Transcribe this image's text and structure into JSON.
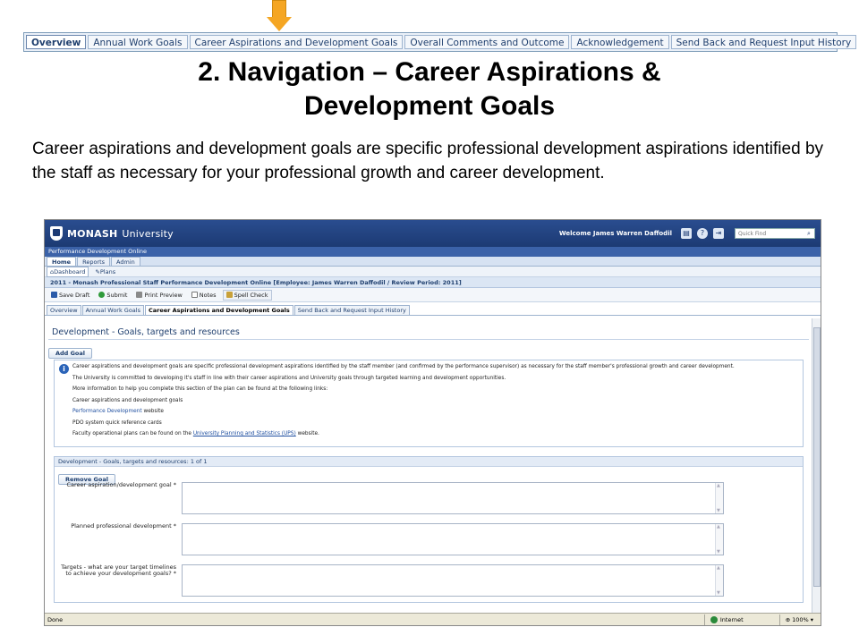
{
  "top_tabs": [
    "Overview",
    "Annual Work Goals",
    "Career Aspirations and Development Goals",
    "Overall Comments and Outcome",
    "Acknowledgement",
    "Send Back and Request Input History"
  ],
  "slide": {
    "title_line1": "2. Navigation – Career Aspirations &",
    "title_line2": "Development Goals",
    "intro": "Career aspirations and development goals are specific professional development aspirations identified by the staff as necessary for your professional growth and career development."
  },
  "app": {
    "logo_main": "MONASH",
    "logo_sub": "University",
    "welcome": "Welcome James Warren Daffodil",
    "quickfind_placeholder": "Quick Find",
    "pdo_bar": "Performance Development Online",
    "nav": [
      "Home",
      "Reports",
      "Admin"
    ],
    "subnav": [
      "Dashboard",
      "Plans"
    ],
    "plan_title": "2011 - Monash Professional Staff Performance Development Online [Employee: James Warren Daffodil / Review Period: 2011]",
    "toolbar": {
      "save_draft": "Save Draft",
      "submit": "Submit",
      "print_preview": "Print Preview",
      "notes": "Notes",
      "spell_check": "Spell Check"
    },
    "form_tabs": [
      "Overview",
      "Annual Work Goals",
      "Career Aspirations and Development Goals",
      "Send Back and Request Input History"
    ],
    "section_title": "Development - Goals, targets and resources",
    "add_goal": "Add Goal",
    "info": {
      "p1": "Career aspirations and development goals are specific professional development aspirations identified by the staff member (and confirmed by the performance supervisor) as necessary for the staff member's professional growth and career development.",
      "p2": "The University is committed to developing it's staff in line with their career aspirations and University goals through targeted learning and development opportunities.",
      "p3": "More information to help you complete this section of the plan can be found at the following links:",
      "p4": "Career aspirations and development goals",
      "p5_link": "Performance Development",
      "p5_rest": " website",
      "p6": "PDO system quick reference cards",
      "p7_pre": "Faculty operational plans can be found on the ",
      "p7_link": "University Planning and Statistics (UPS)",
      "p7_post": " website."
    },
    "subpanel_title": "Development - Goals, targets and resources: 1 of 1",
    "remove_goal": "Remove Goal",
    "fields": [
      {
        "label": "Career aspiration/development goal *"
      },
      {
        "label": "Planned professional development *"
      },
      {
        "label": "Targets - what are your target timelines to achieve your development goals? *"
      }
    ],
    "status": {
      "left": "Done",
      "zone": "Internet",
      "zoom": "100%"
    }
  }
}
